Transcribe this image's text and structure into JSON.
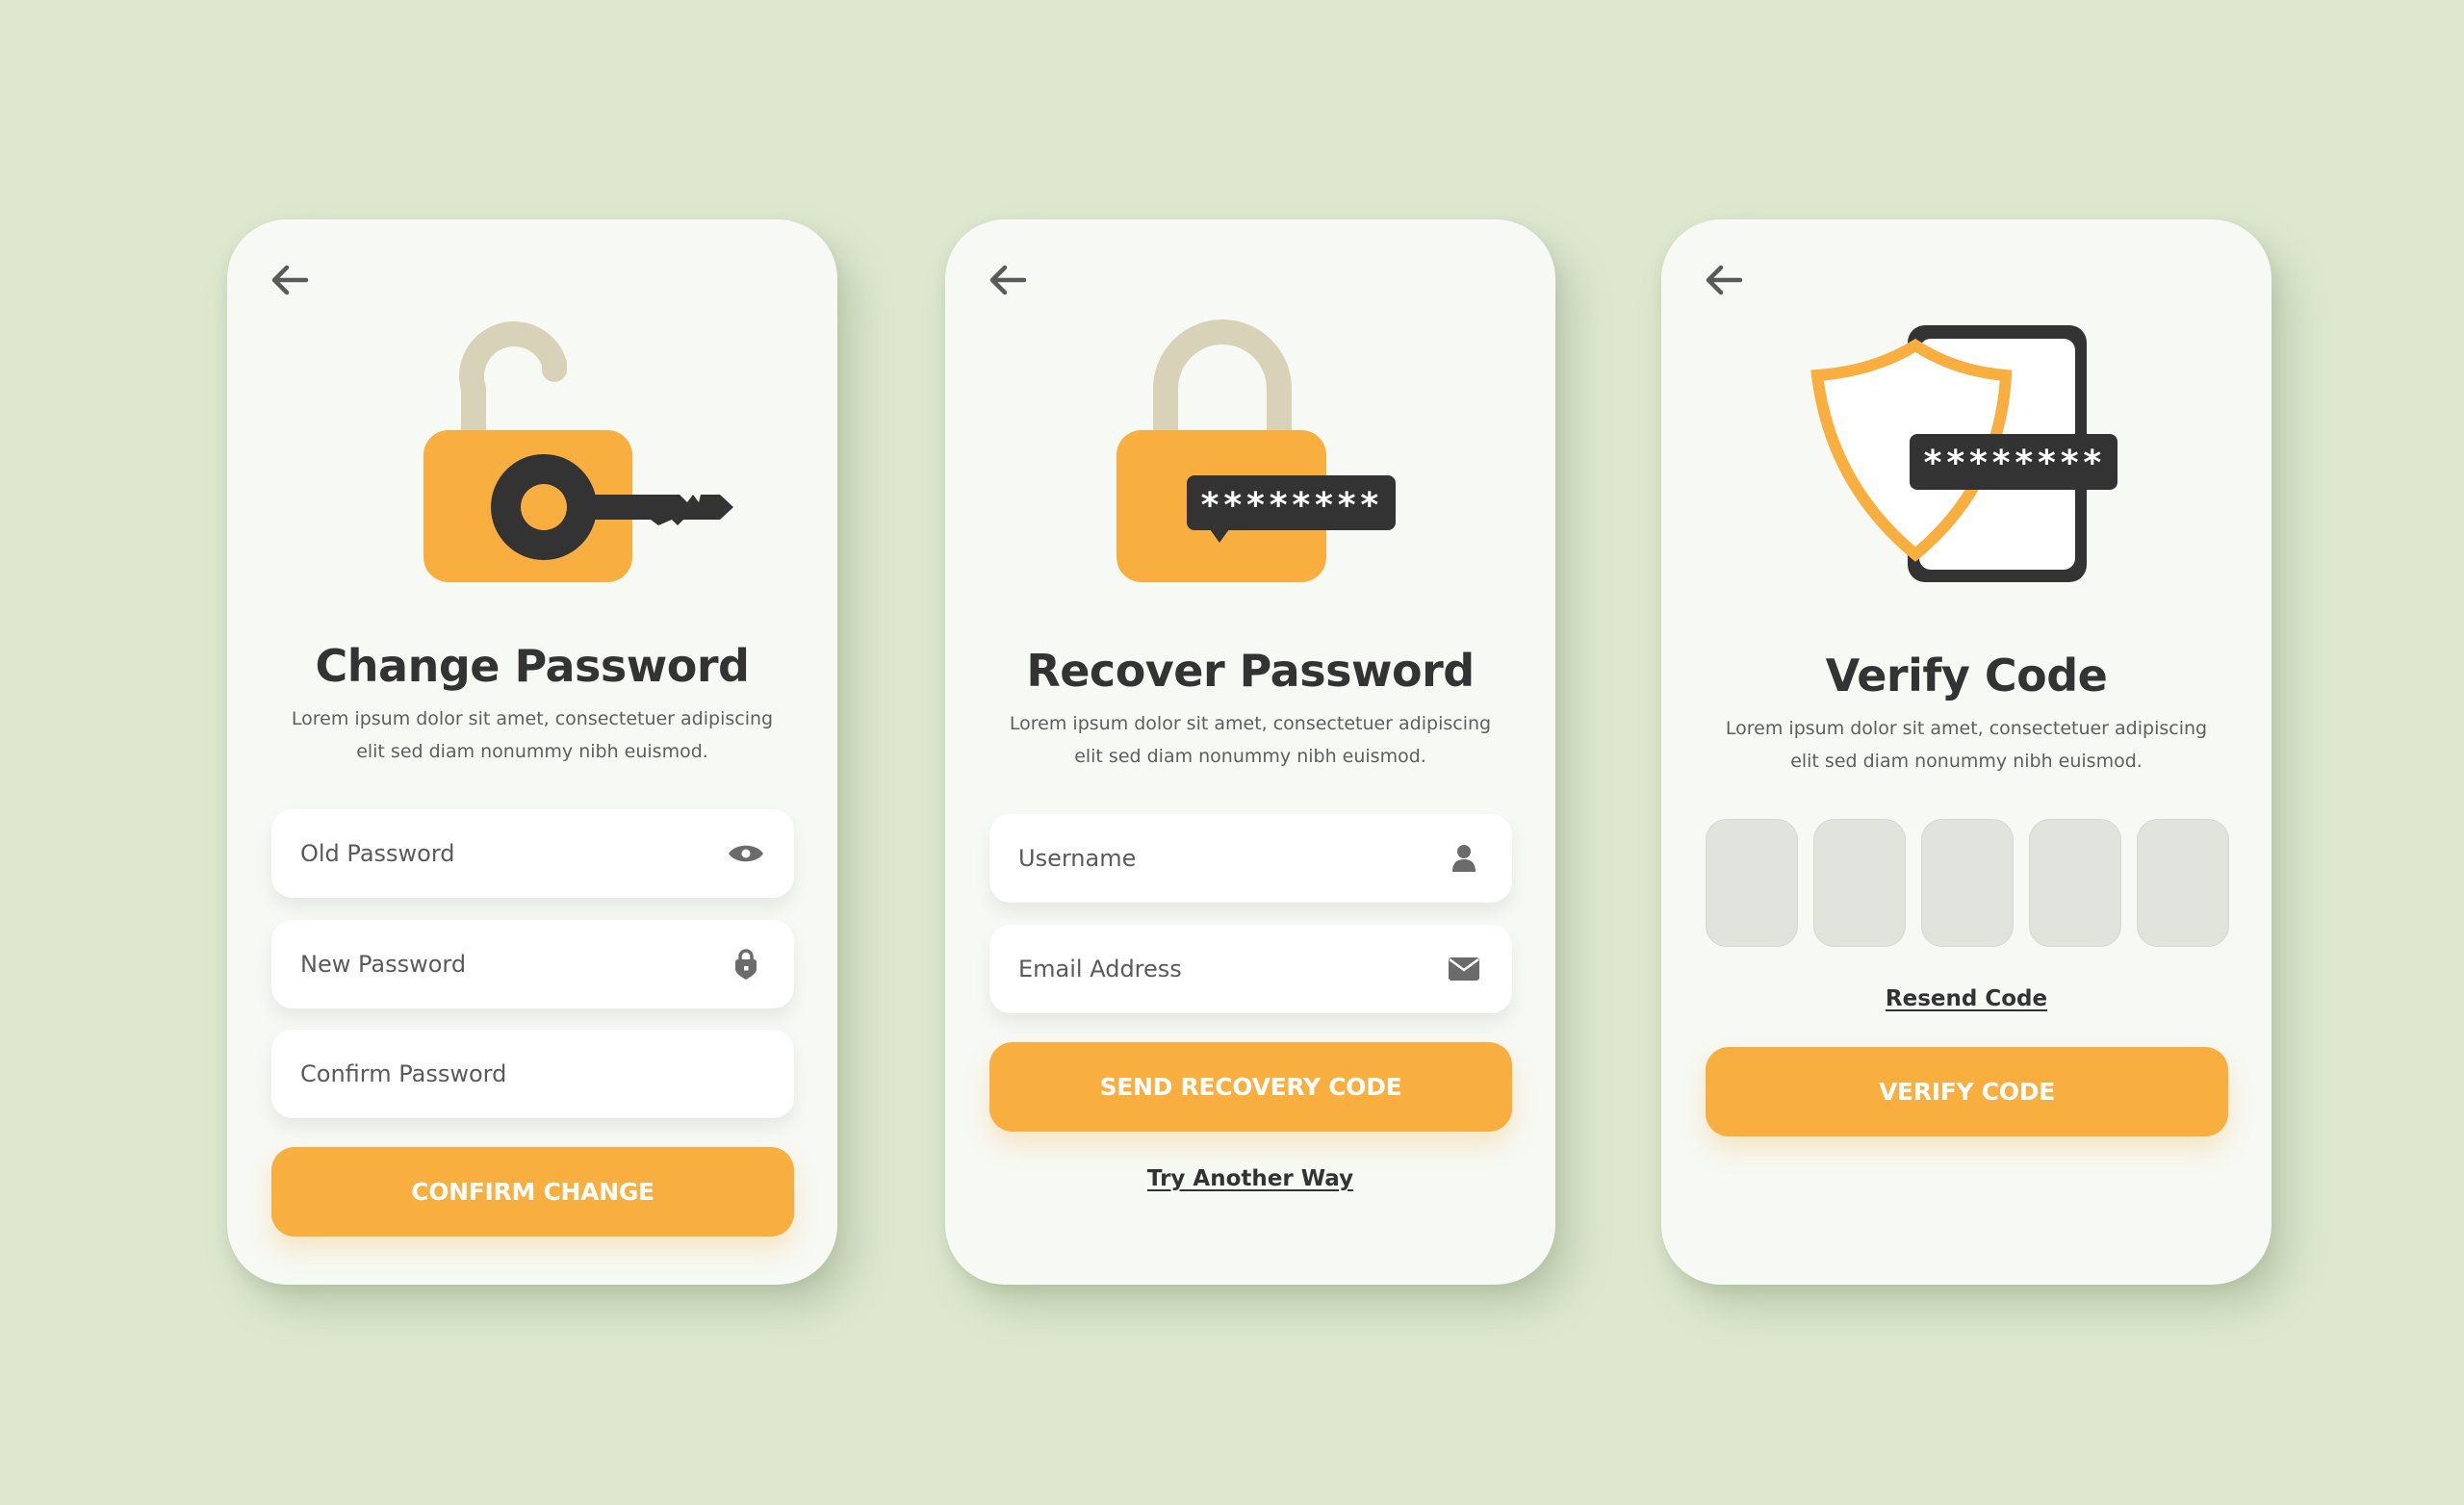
{
  "colors": {
    "background": "#DDE8CF",
    "card": "#F7F9F4",
    "accent": "#F9AE40",
    "dark": "#333333",
    "shackle": "#D8D2B8",
    "icon_gray": "#6B6B6B",
    "otp_box": "#E1E3DD"
  },
  "screens": {
    "change_password": {
      "back_icon": "arrow-left-icon",
      "illustration": "unlocked-padlock-with-key",
      "title": "Change Password",
      "description_line1": "Lorem ipsum dolor sit amet, consectetuer adipiscing",
      "description_line2": "elit sed diam nonummy nibh euismod.",
      "fields": [
        {
          "placeholder": "Old Password",
          "value": "",
          "icon": "eye-icon"
        },
        {
          "placeholder": "New Password",
          "value": "",
          "icon": "lock-icon"
        },
        {
          "placeholder": "Confirm Password",
          "value": "",
          "icon": ""
        }
      ],
      "button_label": "CONFIRM CHANGE"
    },
    "recover_password": {
      "back_icon": "arrow-left-icon",
      "illustration": "padlock-with-password-bubble",
      "bubble_text": "********",
      "title": "Recover Password",
      "description_line1": "Lorem ipsum dolor sit amet, consectetuer adipiscing",
      "description_line2": "elit sed diam nonummy nibh euismod.",
      "fields": [
        {
          "placeholder": "Username",
          "value": "",
          "icon": "user-icon"
        },
        {
          "placeholder": "Email Address",
          "value": "",
          "icon": "mail-icon"
        }
      ],
      "button_label": "SEND RECOVERY CODE",
      "link_label": "Try Another Way"
    },
    "verify_code": {
      "back_icon": "arrow-left-icon",
      "illustration": "shield-phone-password",
      "bubble_text": "********",
      "title": "Verify Code",
      "description_line1": "Lorem ipsum dolor sit amet, consectetuer adipiscing",
      "description_line2": "elit sed diam nonummy nibh euismod.",
      "otp_digits": [
        "",
        "",
        "",
        "",
        ""
      ],
      "link_label": "Resend Code",
      "button_label": "VERIFY CODE"
    }
  }
}
